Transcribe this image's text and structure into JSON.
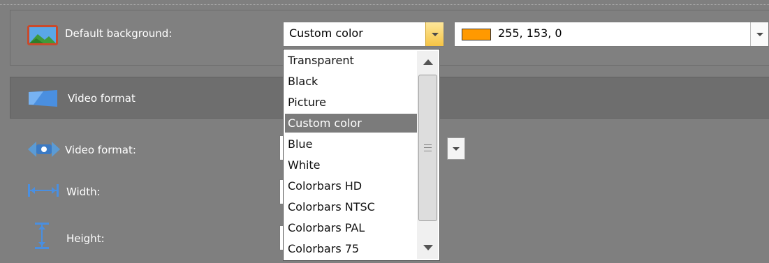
{
  "background_row": {
    "label": "Default background:",
    "selected": "Custom color",
    "color_value": "255, 153, 0",
    "swatch_color": "#ff9900"
  },
  "section": {
    "title": "Video format"
  },
  "fields": [
    {
      "label": "Video format:",
      "icon": "video-format-icon"
    },
    {
      "label": "Width:",
      "icon": "width-icon"
    },
    {
      "label": "Height:",
      "icon": "height-icon"
    }
  ],
  "dropdown": {
    "options": [
      "Transparent",
      "Black",
      "Picture",
      "Custom color",
      "Blue",
      "White",
      "Colorbars HD",
      "Colorbars NTSC",
      "Colorbars PAL",
      "Colorbars 75"
    ],
    "selected_index": 3
  }
}
